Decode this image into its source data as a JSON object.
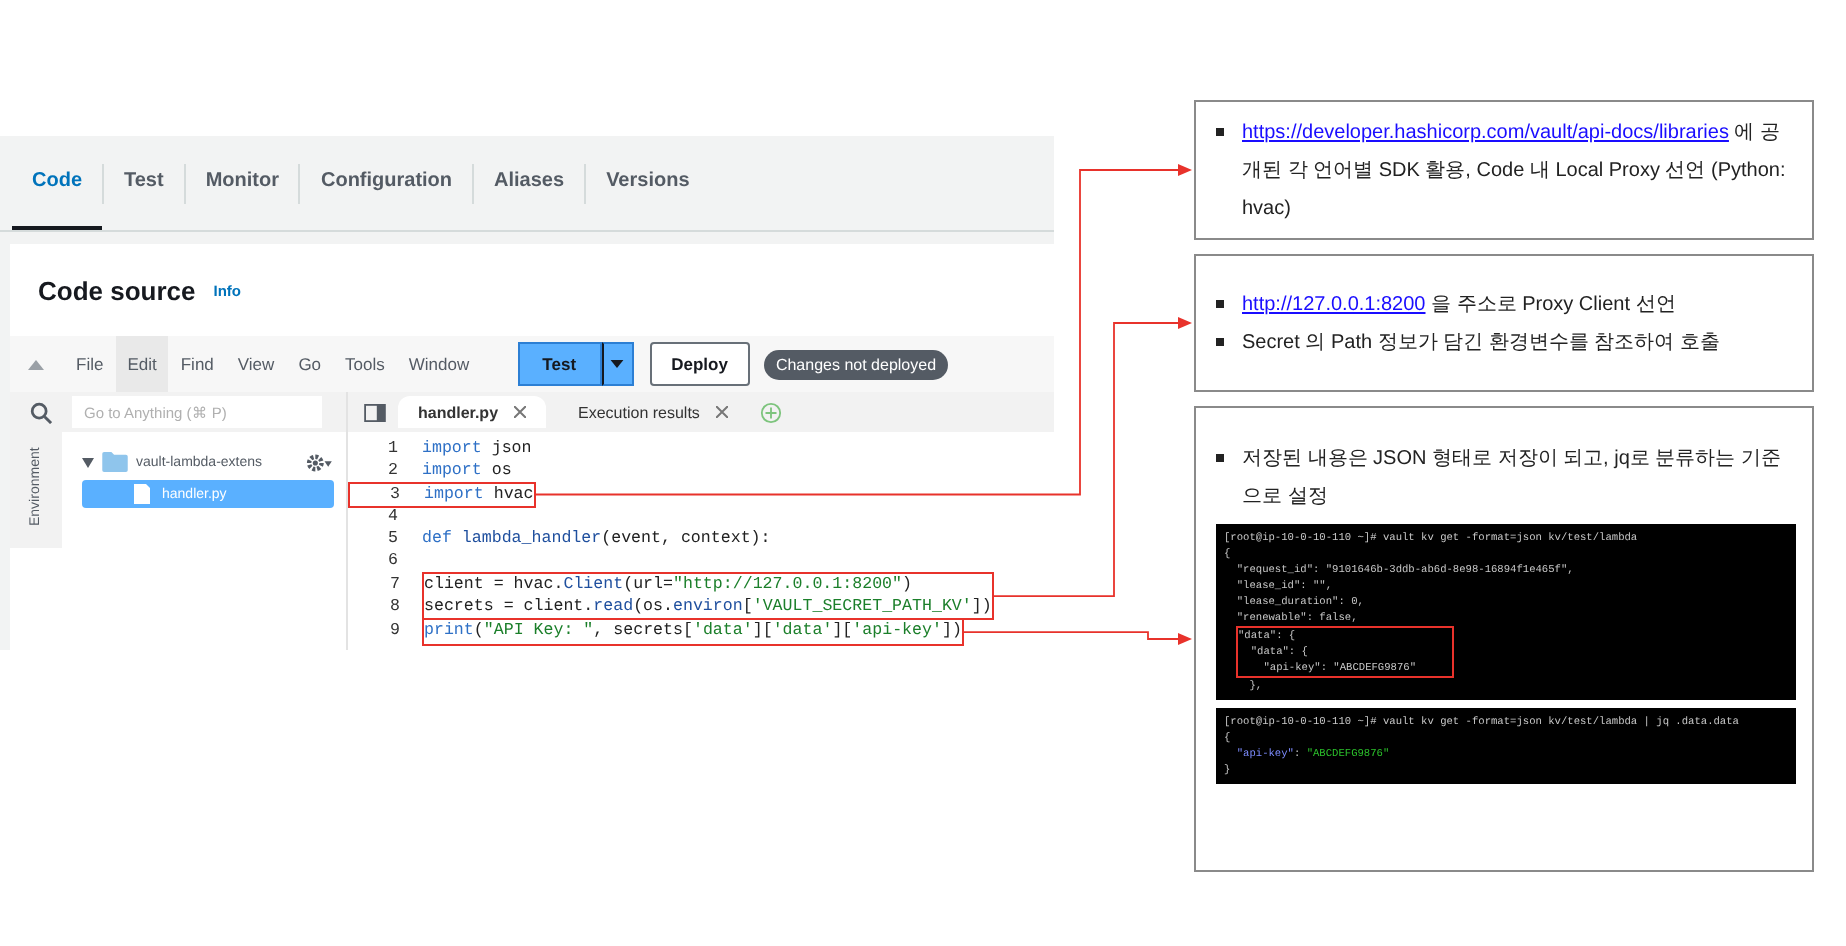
{
  "console": {
    "tabs": [
      {
        "label": "Code",
        "selected": true
      },
      {
        "label": "Test",
        "selected": false
      },
      {
        "label": "Monitor",
        "selected": false
      },
      {
        "label": "Configuration",
        "selected": false
      },
      {
        "label": "Aliases",
        "selected": false
      },
      {
        "label": "Versions",
        "selected": false
      }
    ],
    "section_title": "Code source",
    "info_link": "Info",
    "menu": [
      {
        "label": "File",
        "selected": false
      },
      {
        "label": "Edit",
        "selected": true
      },
      {
        "label": "Find",
        "selected": false
      },
      {
        "label": "View",
        "selected": false
      },
      {
        "label": "Go",
        "selected": false
      },
      {
        "label": "Tools",
        "selected": false
      },
      {
        "label": "Window",
        "selected": false
      }
    ],
    "test_button": "Test",
    "deploy_button": "Deploy",
    "status_badge": "Changes not deployed",
    "search": {
      "placeholder": "Go to Anything (⌘ P)"
    },
    "side_tab": "Environment",
    "tree": [
      {
        "label": "vault-lambda-extens",
        "expanded": true,
        "children": [
          {
            "label": "handler.py",
            "selected": true
          }
        ]
      }
    ],
    "editor_tabs": [
      {
        "label": "handler.py",
        "selected": true
      },
      {
        "label": "Execution results",
        "selected": false
      }
    ],
    "code": [
      {
        "boxed": false,
        "indent": false,
        "lines": [
          {
            "number": "1",
            "tokens": [
              {
                "kind": "keyword",
                "text": "import"
              },
              {
                "kind": "plain",
                "text": " json"
              }
            ]
          },
          {
            "number": "2",
            "tokens": [
              {
                "kind": "keyword",
                "text": "import"
              },
              {
                "kind": "plain",
                "text": " os"
              }
            ]
          }
        ]
      },
      {
        "boxed": true,
        "indent": false,
        "lines": [
          {
            "number": "3",
            "tokens": [
              {
                "kind": "keyword",
                "text": "import"
              },
              {
                "kind": "plain",
                "text": " hvac"
              }
            ]
          }
        ]
      },
      {
        "boxed": false,
        "indent": false,
        "lines": [
          {
            "number": "4"
          },
          {
            "number": "5",
            "tokens": [
              {
                "kind": "keyword",
                "text": "def"
              },
              {
                "kind": "function",
                "text": " lambda_handler"
              },
              {
                "kind": "plain",
                "text": "(event, context):"
              }
            ]
          },
          {
            "number": "6"
          }
        ]
      },
      {
        "boxed": true,
        "indent": true,
        "lines": [
          {
            "number": "7",
            "tokens": [
              {
                "kind": "plain",
                "text": "client = hvac."
              },
              {
                "kind": "function",
                "text": "Client"
              },
              {
                "kind": "plain",
                "text": "(url="
              },
              {
                "kind": "string",
                "text": "\"http://127.0.0.1:8200\""
              },
              {
                "kind": "plain",
                "text": ")"
              }
            ]
          },
          {
            "number": "8",
            "tokens": [
              {
                "kind": "plain",
                "text": "secrets = client."
              },
              {
                "kind": "function",
                "text": "read"
              },
              {
                "kind": "plain",
                "text": "(os."
              },
              {
                "kind": "function",
                "text": "environ"
              },
              {
                "kind": "plain",
                "text": "["
              },
              {
                "kind": "string",
                "text": "'VAULT_SECRET_PATH_KV'"
              },
              {
                "kind": "plain",
                "text": "])"
              }
            ]
          }
        ]
      },
      {
        "boxed": true,
        "indent": true,
        "lines": [
          {
            "number": "9",
            "tokens": [
              {
                "kind": "keyword",
                "text": "print"
              },
              {
                "kind": "plain",
                "text": "("
              },
              {
                "kind": "string",
                "text": "\"API Key: \""
              },
              {
                "kind": "plain",
                "text": ", secrets["
              },
              {
                "kind": "string",
                "text": "'data'"
              },
              {
                "kind": "plain",
                "text": "]["
              },
              {
                "kind": "string",
                "text": "'data'"
              },
              {
                "kind": "plain",
                "text": "]["
              },
              {
                "kind": "string",
                "text": "'api-key'"
              },
              {
                "kind": "plain",
                "text": "])"
              }
            ]
          }
        ]
      }
    ]
  },
  "callouts": [
    {
      "items": [
        {
          "parts": [
            {
              "kind": "link",
              "text": "https://developer.hashicorp.com/vault/api-docs/libraries"
            },
            {
              "kind": "text",
              "text": " 에 공개된 각 언어별 SDK 활용, Code 내 Local Proxy 선언 (Python: hvac)"
            }
          ]
        }
      ]
    },
    {
      "items": [
        {
          "parts": [
            {
              "kind": "link",
              "text": "http://127.0.0.1:8200"
            },
            {
              "kind": "text",
              "text": " 을 주소로 Proxy Client 선언"
            }
          ]
        },
        {
          "parts": [
            {
              "kind": "text",
              "text": "Secret 의 Path 정보가 담긴 환경변수를 참조하여 호출"
            }
          ]
        }
      ]
    },
    {
      "items": [
        {
          "parts": [
            {
              "kind": "text",
              "text": "저장된 내용은 JSON 형태로 저장이 되고, jq로 분류하는 기준으로 설정"
            }
          ]
        }
      ],
      "terminals": [
        {
          "blocks": [
            {
              "boxed": false,
              "lines": [
                [
                  {
                    "kind": "plain",
                    "text": "[root@ip-10-0-10-110 ~]# vault kv get -format=json kv/test/lambda"
                  }
                ],
                [
                  {
                    "kind": "plain",
                    "text": "{"
                  }
                ],
                [
                  {
                    "kind": "plain",
                    "text": "  \"request_id\": \"9101646b-3ddb-ab6d-8e98-16894f1e465f\","
                  }
                ],
                [
                  {
                    "kind": "plain",
                    "text": "  \"lease_id\": \"\","
                  }
                ],
                [
                  {
                    "kind": "plain",
                    "text": "  \"lease_duration\": 0,"
                  }
                ],
                [
                  {
                    "kind": "plain",
                    "text": "  \"renewable\": false,"
                  }
                ]
              ]
            },
            {
              "boxed": true,
              "lines": [
                [
                  {
                    "kind": "plain",
                    "text": "\"data\": {"
                  }
                ],
                [
                  {
                    "kind": "plain",
                    "text": "  \"data\": {"
                  }
                ],
                [
                  {
                    "kind": "plain",
                    "text": "    \"api-key\": \"ABCDEFG9876\""
                  }
                ]
              ]
            },
            {
              "boxed": false,
              "lines": [
                [
                  {
                    "kind": "plain",
                    "text": "    },"
                  }
                ]
              ]
            }
          ]
        },
        {
          "blocks": [
            {
              "boxed": false,
              "lines": [
                [
                  {
                    "kind": "plain",
                    "text": "[root@ip-10-0-10-110 ~]# vault kv get -format=json kv/test/lambda | jq .data.data"
                  }
                ],
                [
                  {
                    "kind": "plain",
                    "text": "{"
                  }
                ],
                [
                  {
                    "kind": "key",
                    "text": "  \"api-key\""
                  },
                  {
                    "kind": "plain",
                    "text": ": "
                  },
                  {
                    "kind": "string",
                    "text": "\"ABCDEFG9876\""
                  }
                ],
                [
                  {
                    "kind": "plain",
                    "text": "}"
                  }
                ]
              ]
            }
          ]
        }
      ]
    }
  ]
}
